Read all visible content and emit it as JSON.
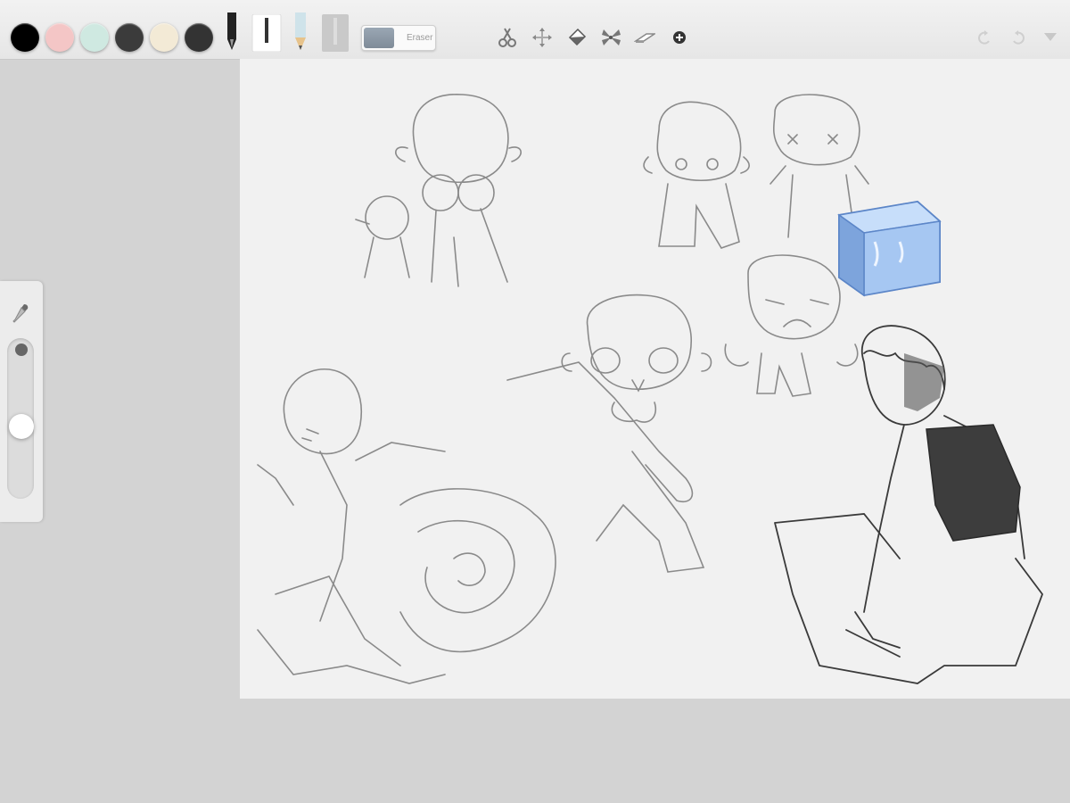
{
  "toolbar": {
    "swatches": [
      {
        "name": "black",
        "color": "#000000"
      },
      {
        "name": "pink",
        "color": "#f4c6c6"
      },
      {
        "name": "mint",
        "color": "#cfe9e1"
      },
      {
        "name": "dark-gray",
        "color": "#3b3b3b"
      },
      {
        "name": "cream",
        "color": "#f3ead6"
      },
      {
        "name": "charcoal",
        "color": "#333333"
      }
    ],
    "eraser_label": "Eraser",
    "tools": [
      "pen-icon",
      "marker-icon",
      "pencil-icon",
      "crayon-icon"
    ],
    "actions": [
      "scissors-icon",
      "move-icon",
      "fill-bucket-icon",
      "fan-brush-icon",
      "smudge-icon",
      "add-icon"
    ],
    "right_actions": [
      "undo-icon",
      "redo-icon",
      "menu-chevron-icon"
    ]
  },
  "side_panel": {
    "eyedropper": "eyedropper-icon",
    "brush_size_dot_color": "#666666",
    "opacity_level": 0.55
  },
  "canvas": {
    "background": "#f1f1f1",
    "sticker": "ice-cube-sticker"
  }
}
